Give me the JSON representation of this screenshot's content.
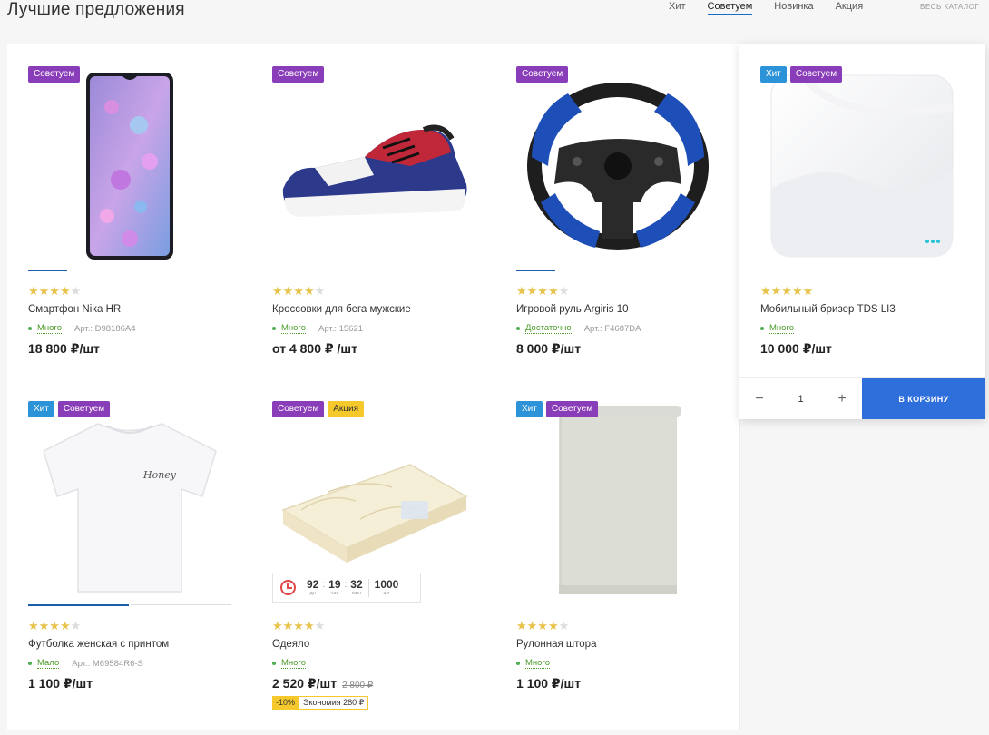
{
  "header": {
    "title": "Лучшие предложения",
    "tabs": [
      {
        "label": "Хит",
        "active": false
      },
      {
        "label": "Советуем",
        "active": true
      },
      {
        "label": "Новинка",
        "active": false
      },
      {
        "label": "Акция",
        "active": false
      }
    ],
    "catalog_link": "ВЕСЬ КАТАЛОГ"
  },
  "products": [
    {
      "badges": [
        "Советуем"
      ],
      "rating": 4,
      "name": "Смартфон Nika HR",
      "stock": "Много",
      "article": "Арт.: D98186A4",
      "price": "18 800 ₽/шт",
      "image_icon": "smartphone-icon"
    },
    {
      "badges": [
        "Советуем"
      ],
      "rating": 4,
      "name": "Кроссовки для бега мужские",
      "stock": "Много",
      "article": "Арт.: 15621",
      "price": "от 4 800 ₽ /шт",
      "image_icon": "sneaker-icon"
    },
    {
      "badges": [
        "Советуем"
      ],
      "rating": 4,
      "name": "Игровой руль Argiris 10",
      "stock": "Достаточно",
      "article": "Арт.: F4687DA",
      "price": "8 000 ₽/шт",
      "image_icon": "steering-wheel-icon"
    },
    {
      "badges": [
        "Хит",
        "Советуем"
      ],
      "rating": 5,
      "name": "Мобильный бризер TDS LI3",
      "stock": "Много",
      "article": "",
      "price": "10 000 ₽/шт",
      "image_icon": "air-purifier-icon",
      "quantity": "1",
      "cart_label": "В КОРЗИНУ"
    },
    {
      "badges": [
        "Хит",
        "Советуем"
      ],
      "rating": 4,
      "name": "Футболка женская с принтом",
      "stock": "Мало",
      "article": "Арт.: M69584R6-S",
      "price": "1 100 ₽/шт",
      "image_icon": "tshirt-icon",
      "print_text": "Honey"
    },
    {
      "badges": [
        "Советуем",
        "Акция"
      ],
      "rating": 4,
      "name": "Одеяло",
      "stock": "Много",
      "article": "",
      "price": "2 520 ₽/шт",
      "old_price": "2 800 ₽",
      "discount": "-10%",
      "economy": "Экономия 280 ₽",
      "image_icon": "blanket-icon",
      "timer": {
        "days": "92",
        "days_label": "дн",
        "hours": "19",
        "hours_label": "час",
        "minutes": "32",
        "minutes_label": "мин",
        "count": "1000",
        "count_label": "шт"
      }
    },
    {
      "badges": [
        "Хит",
        "Советуем"
      ],
      "rating": 4,
      "name": "Рулонная штора",
      "stock": "Много",
      "article": "",
      "price": "1 100 ₽/шт",
      "image_icon": "roller-blind-icon"
    }
  ],
  "colors": {
    "hit": "#2d93d8",
    "recommend": "#8a3db8",
    "sale": "#f5c92c",
    "accent": "#2f6fdb",
    "stock": "#4b9b2a",
    "star": "#e8c24a"
  }
}
